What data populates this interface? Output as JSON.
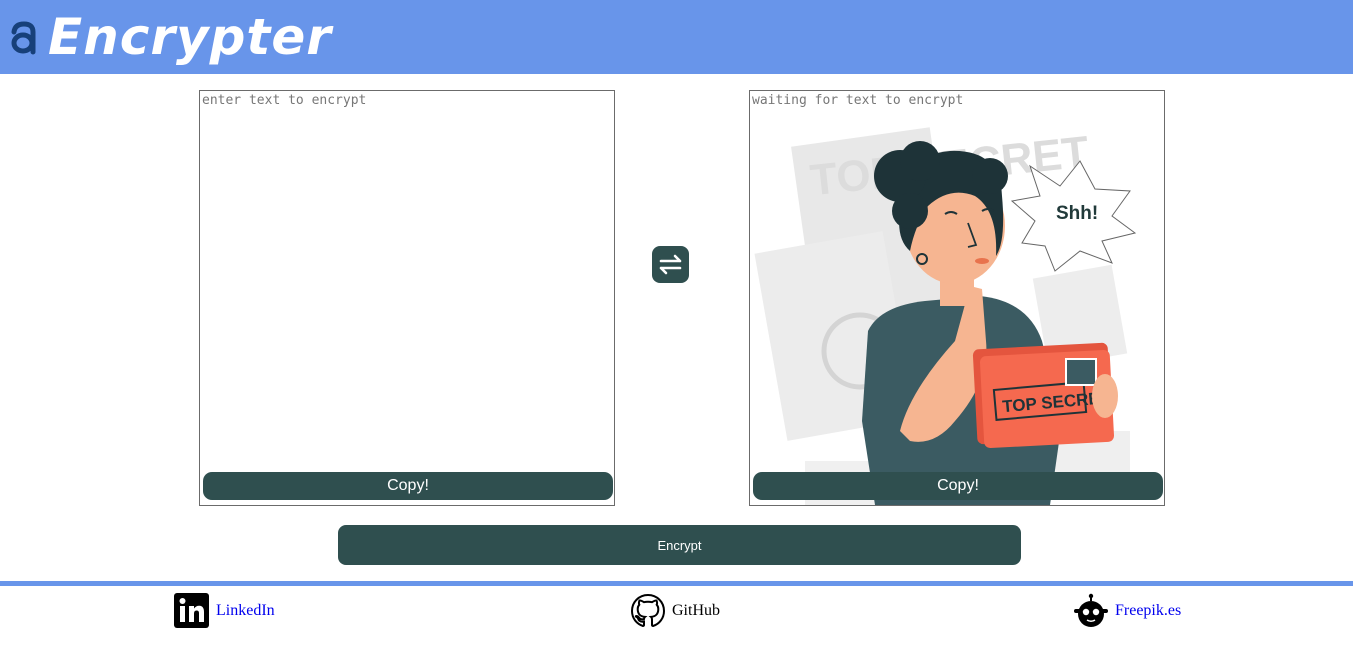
{
  "header": {
    "brand": "Encrypter",
    "logo_icon": "letter-a-logo-icon",
    "background": "#6895ea"
  },
  "input_panel": {
    "placeholder": "enter text to encrypt",
    "copy_label": "Copy!"
  },
  "output_panel": {
    "placeholder": "waiting for text to encrypt",
    "copy_label": "Copy!",
    "illustration": {
      "stamp_text": "TOP SECRET",
      "bubble_text": "Shh!",
      "folder_text": "TOP SECRET"
    }
  },
  "swap": {
    "icon": "swap-arrows-icon"
  },
  "encrypt": {
    "label": "Encrypt"
  },
  "footer": {
    "links": [
      {
        "label": "LinkedIn",
        "icon": "linkedin-icon"
      },
      {
        "label": "GitHub",
        "icon": "github-icon"
      },
      {
        "label": "Freepik.es",
        "icon": "freepik-icon"
      }
    ]
  },
  "colors": {
    "accent": "#6895ea",
    "button": "#2f4f4f",
    "link": "#0000ee"
  }
}
